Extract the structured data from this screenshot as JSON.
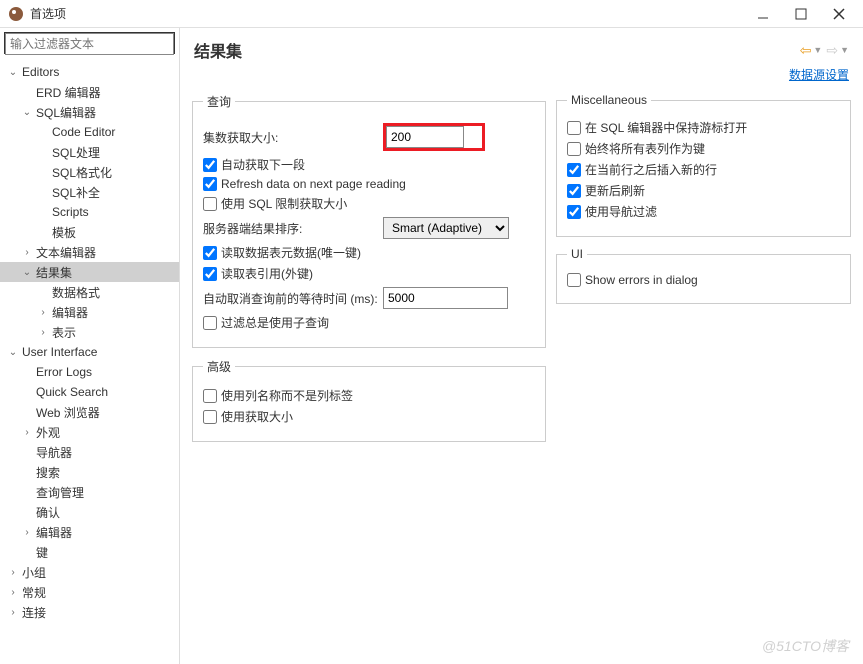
{
  "window": {
    "title": "首选项"
  },
  "sidebar": {
    "filter_placeholder": "输入过滤器文本",
    "items": [
      {
        "label": "Editors",
        "depth": 0,
        "arrow": "v"
      },
      {
        "label": "ERD 编辑器",
        "depth": 1,
        "arrow": ""
      },
      {
        "label": "SQL编辑器",
        "depth": 1,
        "arrow": "v"
      },
      {
        "label": "Code Editor",
        "depth": 2,
        "arrow": ""
      },
      {
        "label": "SQL处理",
        "depth": 2,
        "arrow": ""
      },
      {
        "label": "SQL格式化",
        "depth": 2,
        "arrow": ""
      },
      {
        "label": "SQL补全",
        "depth": 2,
        "arrow": ""
      },
      {
        "label": "Scripts",
        "depth": 2,
        "arrow": ""
      },
      {
        "label": "模板",
        "depth": 2,
        "arrow": ""
      },
      {
        "label": "文本编辑器",
        "depth": 1,
        "arrow": ">"
      },
      {
        "label": "结果集",
        "depth": 1,
        "arrow": "v",
        "selected": true
      },
      {
        "label": "数据格式",
        "depth": 2,
        "arrow": ""
      },
      {
        "label": "编辑器",
        "depth": 2,
        "arrow": ">"
      },
      {
        "label": "表示",
        "depth": 2,
        "arrow": ">"
      },
      {
        "label": "User Interface",
        "depth": 0,
        "arrow": "v"
      },
      {
        "label": "Error Logs",
        "depth": 1,
        "arrow": ""
      },
      {
        "label": "Quick Search",
        "depth": 1,
        "arrow": ""
      },
      {
        "label": "Web 浏览器",
        "depth": 1,
        "arrow": ""
      },
      {
        "label": "外观",
        "depth": 1,
        "arrow": ">"
      },
      {
        "label": "导航器",
        "depth": 1,
        "arrow": ""
      },
      {
        "label": "搜索",
        "depth": 1,
        "arrow": ""
      },
      {
        "label": "查询管理",
        "depth": 1,
        "arrow": ""
      },
      {
        "label": "确认",
        "depth": 1,
        "arrow": ""
      },
      {
        "label": "编辑器",
        "depth": 1,
        "arrow": ">"
      },
      {
        "label": "键",
        "depth": 1,
        "arrow": ""
      },
      {
        "label": "小组",
        "depth": 0,
        "arrow": ">"
      },
      {
        "label": "常规",
        "depth": 0,
        "arrow": ">"
      },
      {
        "label": "连接",
        "depth": 0,
        "arrow": ">"
      }
    ]
  },
  "content": {
    "title": "结果集",
    "datasource_link": "数据源设置",
    "query": {
      "legend": "查询",
      "fetch_size_label": "集数获取大小:",
      "fetch_size_value": "200",
      "auto_fetch_next": {
        "label": "自动获取下一段",
        "checked": true
      },
      "refresh_next_page": {
        "label": "Refresh data on next page reading",
        "checked": true
      },
      "use_sql_limit": {
        "label": "使用 SQL 限制获取大小",
        "checked": false
      },
      "server_sort_label": "服务器端结果排序:",
      "server_sort_value": "Smart (Adaptive)",
      "read_meta": {
        "label": "读取数据表元数据(唯一键)",
        "checked": true
      },
      "read_ref": {
        "label": "读取表引用(外键)",
        "checked": true
      },
      "cancel_wait_label": "自动取消查询前的等待时间 (ms):",
      "cancel_wait_value": "5000",
      "filter_subquery": {
        "label": "过滤总是使用子查询",
        "checked": false
      }
    },
    "advanced": {
      "legend": "高级",
      "use_col_name": {
        "label": "使用列名称而不是列标签",
        "checked": false
      },
      "use_fetch_size": {
        "label": "使用获取大小",
        "checked": false
      }
    },
    "misc": {
      "legend": "Miscellaneous",
      "keep_cursor": {
        "label": "在 SQL 编辑器中保持游标打开",
        "checked": false
      },
      "all_cols_as_keys": {
        "label": "始终将所有表列作为键",
        "checked": false
      },
      "insert_after_row": {
        "label": "在当前行之后插入新的行",
        "checked": true
      },
      "refresh_after_update": {
        "label": "更新后刷新",
        "checked": true
      },
      "use_nav_filter": {
        "label": "使用导航过滤",
        "checked": true
      }
    },
    "ui": {
      "legend": "UI",
      "show_errors_dialog": {
        "label": "Show errors in dialog",
        "checked": false
      }
    }
  },
  "watermark": "@51CTO博客"
}
